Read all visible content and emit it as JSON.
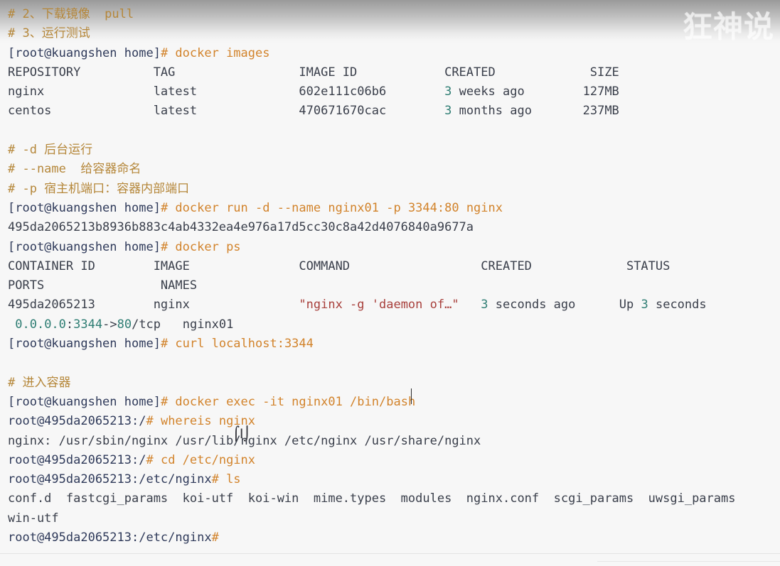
{
  "watermark": {
    "text": "狂神说"
  },
  "terminal": {
    "lines": [
      {
        "name": "comment-pull",
        "segments": [
          {
            "cls": "c-comment",
            "text": "# 2、下载镜像  pull"
          }
        ]
      },
      {
        "name": "comment-run-test",
        "segments": [
          {
            "cls": "c-comment",
            "text": "# 3、运行测试"
          }
        ]
      },
      {
        "name": "prompt-docker-images",
        "segments": [
          {
            "cls": "c-prompt",
            "text": "[root@kuangshen home]"
          },
          {
            "cls": "c-hash",
            "text": "#"
          },
          {
            "cls": "c-cmd",
            "text": " docker images"
          }
        ]
      },
      {
        "name": "images-header",
        "segments": [
          {
            "cls": "c-out",
            "text": "REPOSITORY          TAG                 IMAGE ID            CREATED             SIZE"
          }
        ]
      },
      {
        "name": "images-row-nginx",
        "segments": [
          {
            "cls": "c-out",
            "text": "nginx               latest              "
          },
          {
            "cls": "c-out",
            "text": "602e111c06b6"
          },
          {
            "cls": "c-out",
            "text": "        "
          },
          {
            "cls": "c-num",
            "text": "3"
          },
          {
            "cls": "c-out",
            "text": " weeks ago        "
          },
          {
            "cls": "c-out",
            "text": "127MB"
          }
        ]
      },
      {
        "name": "images-row-centos",
        "segments": [
          {
            "cls": "c-out",
            "text": "centos              latest              "
          },
          {
            "cls": "c-out",
            "text": "470671670cac"
          },
          {
            "cls": "c-out",
            "text": "        "
          },
          {
            "cls": "c-num",
            "text": "3"
          },
          {
            "cls": "c-out",
            "text": " months ago       "
          },
          {
            "cls": "c-out",
            "text": "237MB"
          }
        ]
      },
      {
        "name": "blank-1",
        "segments": []
      },
      {
        "name": "comment-d",
        "segments": [
          {
            "cls": "c-comment",
            "text": "# -d 后台运行"
          }
        ]
      },
      {
        "name": "comment-name",
        "segments": [
          {
            "cls": "c-comment",
            "text": "# --name  给容器命名"
          }
        ]
      },
      {
        "name": "comment-p",
        "segments": [
          {
            "cls": "c-comment",
            "text": "# -p 宿主机端口：容器内部端口"
          }
        ]
      },
      {
        "name": "prompt-docker-run",
        "segments": [
          {
            "cls": "c-prompt",
            "text": "[root@kuangshen home]"
          },
          {
            "cls": "c-hash",
            "text": "#"
          },
          {
            "cls": "c-cmd",
            "text": " docker run -d --name nginx01 -p 3344:80 nginx"
          }
        ]
      },
      {
        "name": "run-container-hash",
        "segments": [
          {
            "cls": "c-out",
            "text": "495da2065213b8936b883c4ab4332ea4e976a17d5cc30c8a42d4076840a9677a"
          }
        ]
      },
      {
        "name": "prompt-docker-ps",
        "segments": [
          {
            "cls": "c-prompt",
            "text": "[root@kuangshen home]"
          },
          {
            "cls": "c-hash",
            "text": "#"
          },
          {
            "cls": "c-cmd",
            "text": " docker ps"
          }
        ]
      },
      {
        "name": "ps-header-1",
        "segments": [
          {
            "cls": "c-out",
            "text": "CONTAINER ID        IMAGE               COMMAND                  CREATED             STATUS"
          }
        ]
      },
      {
        "name": "ps-header-2",
        "segments": [
          {
            "cls": "c-out",
            "text": "PORTS                NAMES"
          }
        ]
      },
      {
        "name": "ps-row-1",
        "segments": [
          {
            "cls": "c-out",
            "text": "495da2065213        nginx               "
          },
          {
            "cls": "c-str",
            "text": "\"nginx -g 'daemon of…\""
          },
          {
            "cls": "c-out",
            "text": "   "
          },
          {
            "cls": "c-num",
            "text": "3"
          },
          {
            "cls": "c-out",
            "text": " seconds ago      Up "
          },
          {
            "cls": "c-num",
            "text": "3"
          },
          {
            "cls": "c-out",
            "text": " seconds"
          }
        ]
      },
      {
        "name": "ps-row-2",
        "segments": [
          {
            "cls": "c-out",
            "text": " "
          },
          {
            "cls": "c-num",
            "text": "0.0.0.0"
          },
          {
            "cls": "c-out",
            "text": ":"
          },
          {
            "cls": "c-num",
            "text": "3344"
          },
          {
            "cls": "c-out",
            "text": "->"
          },
          {
            "cls": "c-num",
            "text": "80"
          },
          {
            "cls": "c-out",
            "text": "/tcp   nginx01"
          }
        ]
      },
      {
        "name": "prompt-curl",
        "segments": [
          {
            "cls": "c-prompt",
            "text": "[root@kuangshen home]"
          },
          {
            "cls": "c-hash",
            "text": "#"
          },
          {
            "cls": "c-cmd",
            "text": " curl localhost:3344"
          }
        ]
      },
      {
        "name": "blank-2",
        "segments": []
      },
      {
        "name": "comment-enter-container",
        "segments": [
          {
            "cls": "c-comment",
            "text": "# 进入容器"
          }
        ]
      },
      {
        "name": "prompt-docker-exec",
        "segments": [
          {
            "cls": "c-prompt",
            "text": "[root@kuangshen home]"
          },
          {
            "cls": "c-hash",
            "text": "#"
          },
          {
            "cls": "c-cmd",
            "text": " docker exec -it nginx01 /bin/bash"
          }
        ]
      },
      {
        "name": "prompt-whereis",
        "segments": [
          {
            "cls": "c-prompt",
            "text": "root@495da2065213:/"
          },
          {
            "cls": "c-hash",
            "text": "#"
          },
          {
            "cls": "c-cmd",
            "text": " whereis nginx"
          }
        ]
      },
      {
        "name": "whereis-output",
        "segments": [
          {
            "cls": "c-out",
            "text": "nginx: /usr/sbin/nginx /usr/lib/nginx /etc/nginx /usr/share/nginx"
          }
        ]
      },
      {
        "name": "prompt-cd",
        "segments": [
          {
            "cls": "c-prompt",
            "text": "root@495da2065213:/"
          },
          {
            "cls": "c-hash",
            "text": "#"
          },
          {
            "cls": "c-cmd",
            "text": " cd /etc/nginx"
          }
        ]
      },
      {
        "name": "prompt-ls",
        "segments": [
          {
            "cls": "c-prompt",
            "text": "root@495da2065213:/etc/nginx"
          },
          {
            "cls": "c-hash",
            "text": "#"
          },
          {
            "cls": "c-cmd",
            "text": " ls"
          }
        ]
      },
      {
        "name": "ls-output-1",
        "segments": [
          {
            "cls": "c-out",
            "text": "conf.d  fastcgi_params  koi-utf  koi-win  mime.types  modules  nginx.conf  scgi_params  uwsgi_params"
          }
        ]
      },
      {
        "name": "ls-output-2",
        "segments": [
          {
            "cls": "c-out",
            "text": "win-utf"
          }
        ]
      },
      {
        "name": "prompt-final",
        "segments": [
          {
            "cls": "c-prompt",
            "text": "root@495da2065213:/etc/nginx"
          },
          {
            "cls": "c-hash",
            "text": "#"
          }
        ]
      }
    ]
  }
}
